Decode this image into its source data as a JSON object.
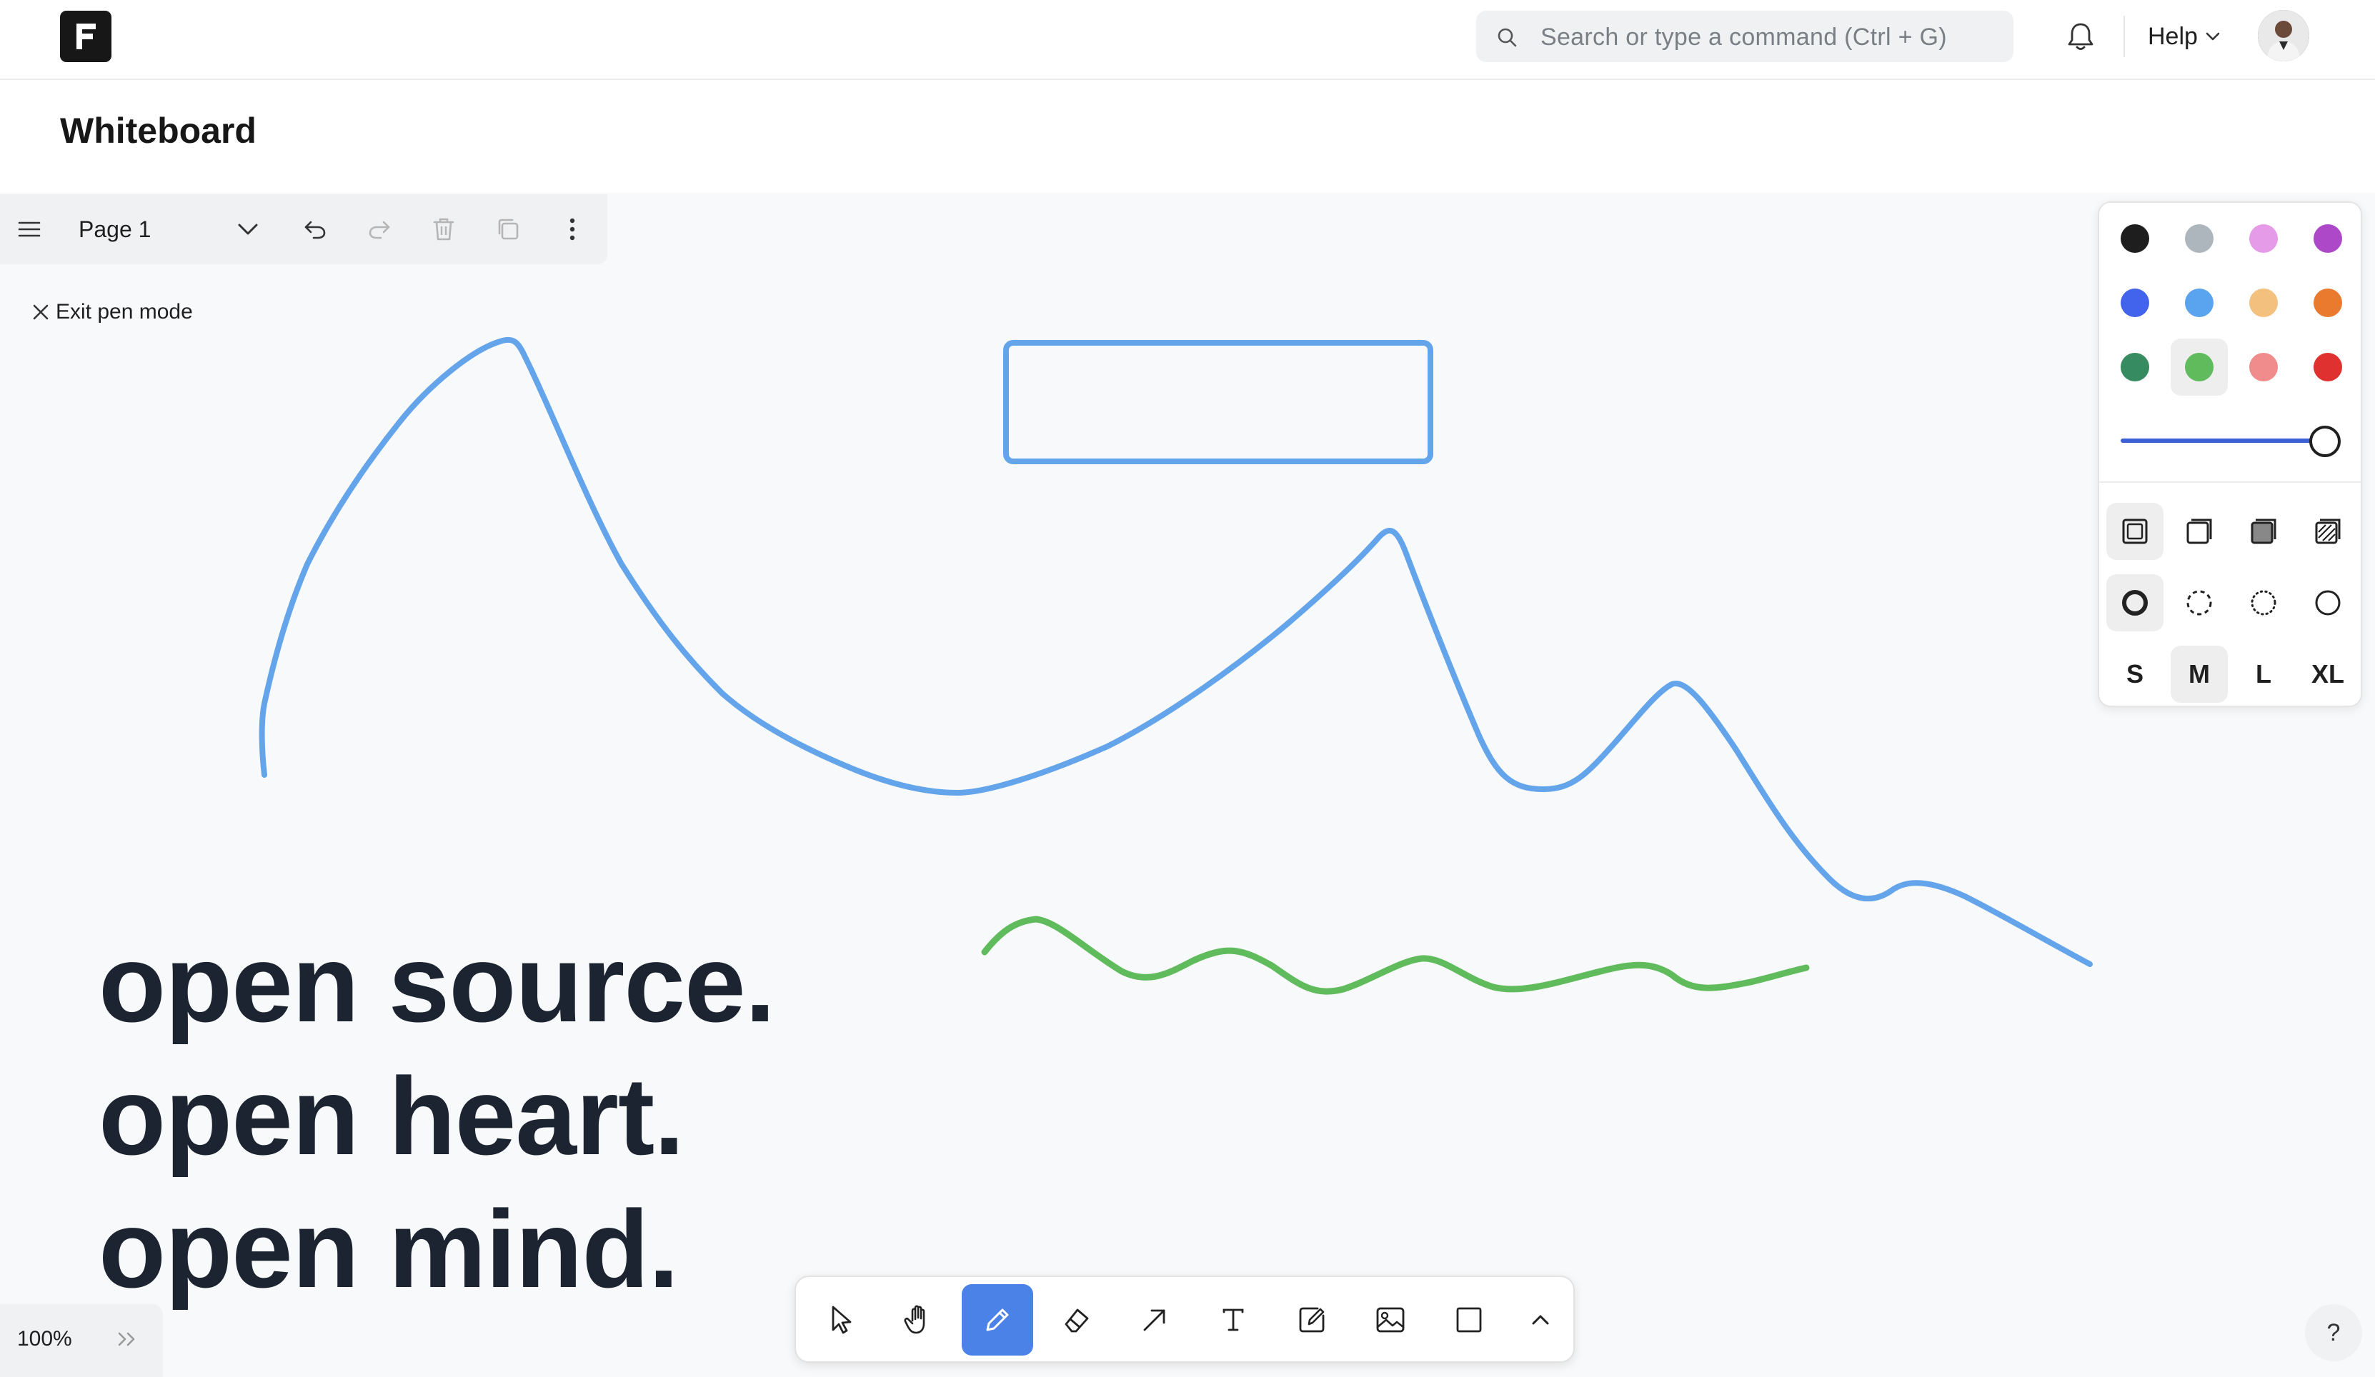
{
  "navbar": {
    "search_placeholder": "Search or type a command (Ctrl + G)",
    "help_label": "Help"
  },
  "page": {
    "title": "Whiteboard"
  },
  "page_toolbar": {
    "page_name": "Page 1"
  },
  "canvas": {
    "exit_pen_label": "Exit pen mode",
    "stroke_colors": {
      "blue": "#63a4ea",
      "green": "#5fbb5c"
    },
    "text_lines": [
      "open source.",
      "open heart.",
      "open mind."
    ]
  },
  "style_panel": {
    "colors": [
      "#1e1e1e",
      "#adb5bd",
      "#e59be8",
      "#ad49c9",
      "#4263eb",
      "#5aa3ee",
      "#f3c07e",
      "#ea7a2d",
      "#378b61",
      "#5fbb5c",
      "#f08c8c",
      "#e03131"
    ],
    "selected_color": "#5fbb5c",
    "opacity": 1,
    "fill_styles": [
      "none",
      "semi",
      "solid",
      "pattern"
    ],
    "dash_styles": [
      "draw",
      "dashed",
      "dotted",
      "solid"
    ],
    "sizes": [
      "S",
      "M",
      "L",
      "XL"
    ],
    "selected_size": "M"
  },
  "tools": [
    "select",
    "hand",
    "draw",
    "eraser",
    "arrow",
    "text",
    "note",
    "media",
    "rectangle",
    "more"
  ],
  "active_tool": "draw",
  "zoom": {
    "label": "100%"
  },
  "help_fab": {
    "label": "?"
  }
}
